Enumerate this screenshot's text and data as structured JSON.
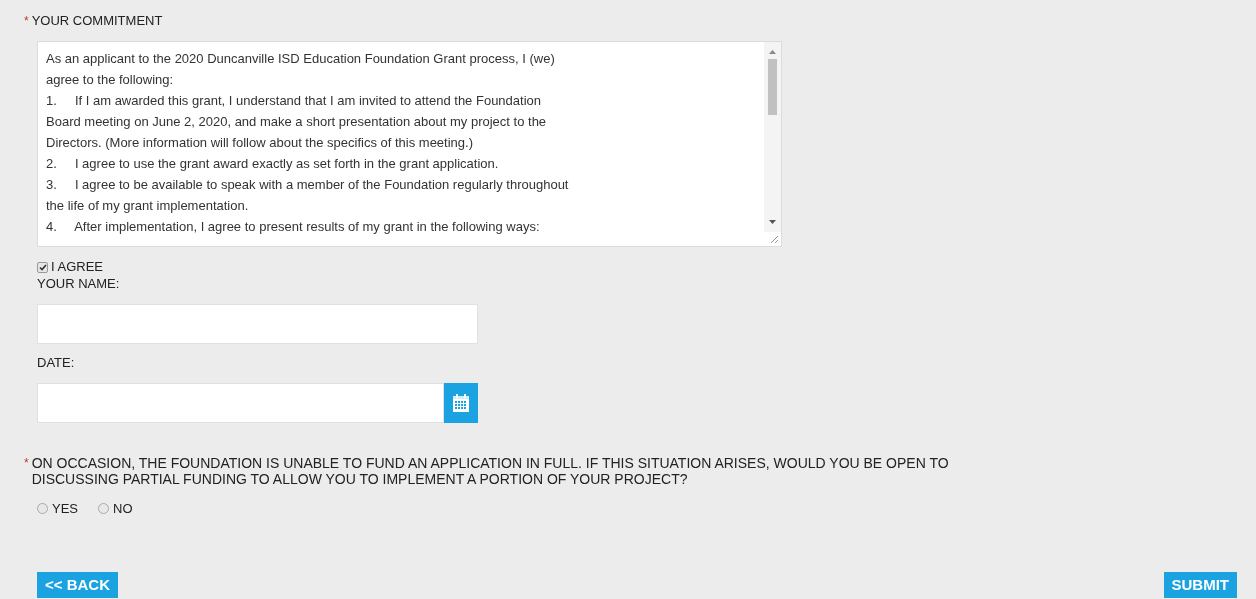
{
  "commitment": {
    "marker": "*",
    "label": "YOUR COMMITMENT",
    "lines": [
      "As an applicant to the 2020 Duncanville ISD Education Foundation Grant process, I (we)",
      "agree to the following:",
      "1.     If I am awarded this grant, I understand that I am invited to attend the Foundation",
      "Board meeting on June 2, 2020, and make a short presentation about my project to the",
      "Directors. (More information will follow about the specifics of this meeting.)",
      "2.     I agree to use the grant award exactly as set forth in the grant application.",
      "3.     I agree to be available to speak with a member of the Foundation regularly throughout",
      "the life of my grant implementation.",
      "4.     After implementation, I agree to present results of my grant in the following ways:"
    ]
  },
  "agree": {
    "label": "I AGREE",
    "checked": true
  },
  "name_field": {
    "label": "YOUR NAME:"
  },
  "date_field": {
    "label": "DATE:"
  },
  "question": {
    "marker": "*",
    "label": "ON OCCASION, THE FOUNDATION IS UNABLE TO FUND AN APPLICATION IN FULL. IF THIS SITUATION ARISES, WOULD YOU BE OPEN TO DISCUSSING PARTIAL FUNDING TO ALLOW YOU TO IMPLEMENT A PORTION OF YOUR PROJECT?",
    "options": [
      {
        "label": "YES",
        "selected": false
      },
      {
        "label": "NO",
        "selected": false
      }
    ]
  },
  "buttons": {
    "back": "<< BACK",
    "submit": "SUBMIT"
  }
}
